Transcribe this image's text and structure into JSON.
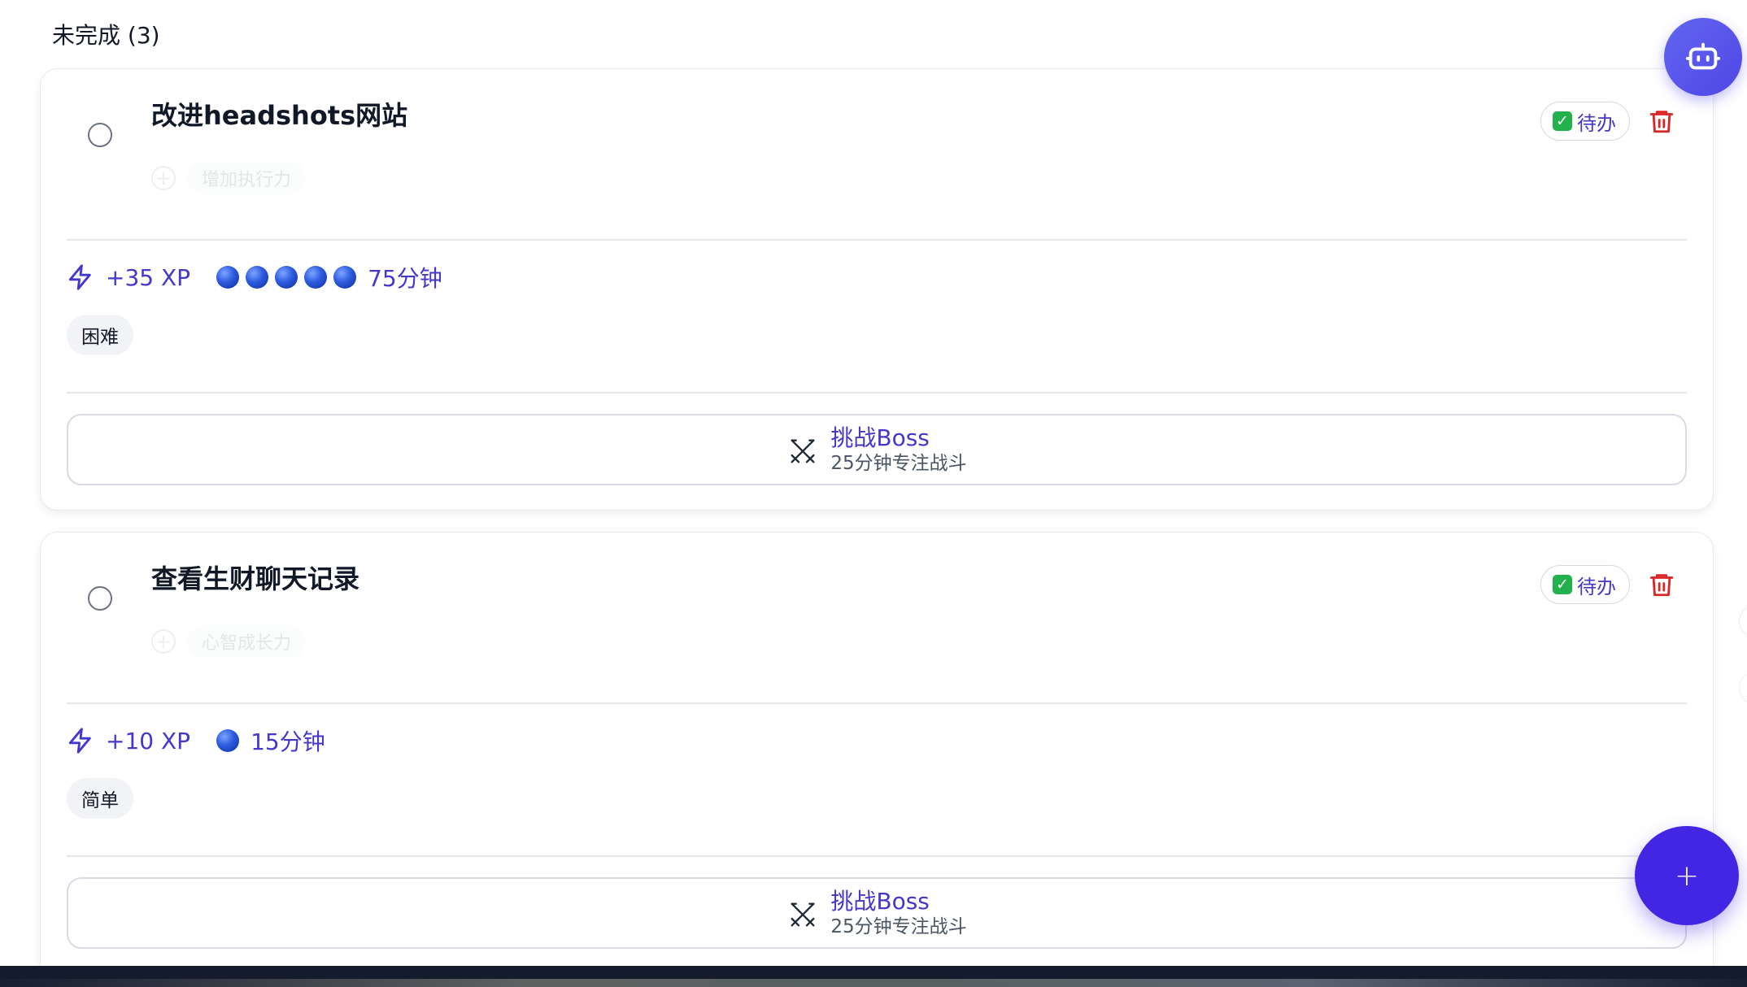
{
  "section": {
    "title": "未完成 (3)"
  },
  "tasks": [
    {
      "title": "改进headshots网站",
      "ghost_tag": "增加执行力",
      "status": "待办",
      "xp": "+35 XP",
      "duration": "75分钟",
      "duration_level": 5,
      "difficulty": "困难",
      "boss_title": "挑战Boss",
      "boss_subtitle": "25分钟专注战斗"
    },
    {
      "title": "查看生财聊天记录",
      "ghost_tag": "心智成长力",
      "status": "待办",
      "xp": "+10 XP",
      "duration": "15分钟",
      "duration_level": 1,
      "difficulty": "简单",
      "boss_title": "挑战Boss",
      "boss_subtitle": "25分钟专注战斗"
    }
  ],
  "fab": {
    "add_label": "+"
  },
  "icons": {
    "checkbox": "circle-checkbox-icon",
    "status": "check-mark-emoji-icon",
    "delete": "trash-icon",
    "xp": "lightning-bolt-icon",
    "duration_unit": "blue-circle-icon",
    "boss": "crossed-swords-icon",
    "assistant": "robot-icon",
    "add": "plus-icon"
  },
  "colors": {
    "accent": "#4338ca",
    "fab": "#4226e3",
    "delete": "#dc2626",
    "status_check": "#22b14c"
  }
}
